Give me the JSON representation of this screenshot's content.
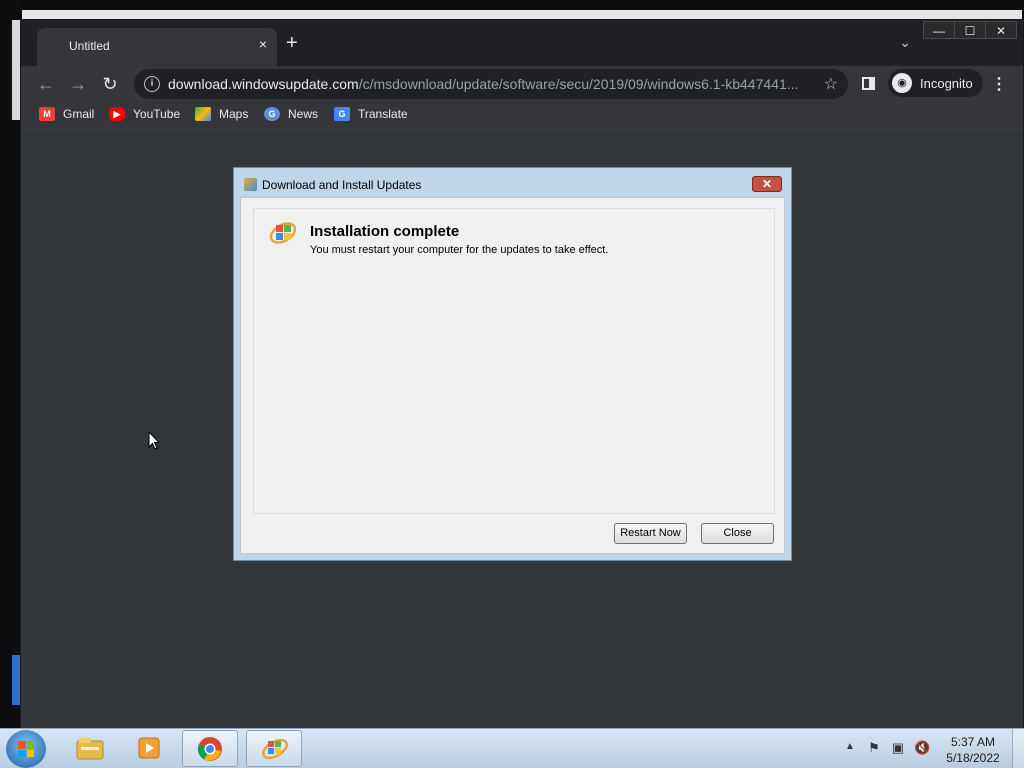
{
  "browser": {
    "tab_title": "Untitled",
    "tab_close": "×",
    "new_tab": "+",
    "tab_search": "⌄",
    "url_host": "download.windowsupdate.com",
    "url_path": "/c/msdownload/update/software/secu/2019/09/windows6.1-kb447441...",
    "incognito_label": "Incognito",
    "bookmarks": [
      {
        "label": "Gmail",
        "color": "#ea4335",
        "icon": "gmail-icon"
      },
      {
        "label": "YouTube",
        "color": "#ff0000",
        "icon": "youtube-icon"
      },
      {
        "label": "Maps",
        "color": "#34a853",
        "icon": "maps-icon"
      },
      {
        "label": "News",
        "color": "#4285f4",
        "icon": "news-icon"
      },
      {
        "label": "Translate",
        "color": "#4285f4",
        "icon": "translate-icon"
      }
    ]
  },
  "dialog": {
    "title": "Download and Install Updates",
    "close_symbol": "✕",
    "heading": "Installation complete",
    "message": "You must restart your computer for the updates to take effect.",
    "restart_button": "Restart Now",
    "close_button": "Close"
  },
  "taskbar": {
    "time": "5:37 AM",
    "date": "5/18/2022",
    "items": [
      "explorer-icon",
      "media-player-icon",
      "chrome-icon",
      "windows-update-icon"
    ]
  },
  "colors": {
    "browser_bg": "#323639",
    "toolbar": "#35363a",
    "dialog_frame": "#bfd6ea",
    "taskbar": "#c8d9ea"
  }
}
